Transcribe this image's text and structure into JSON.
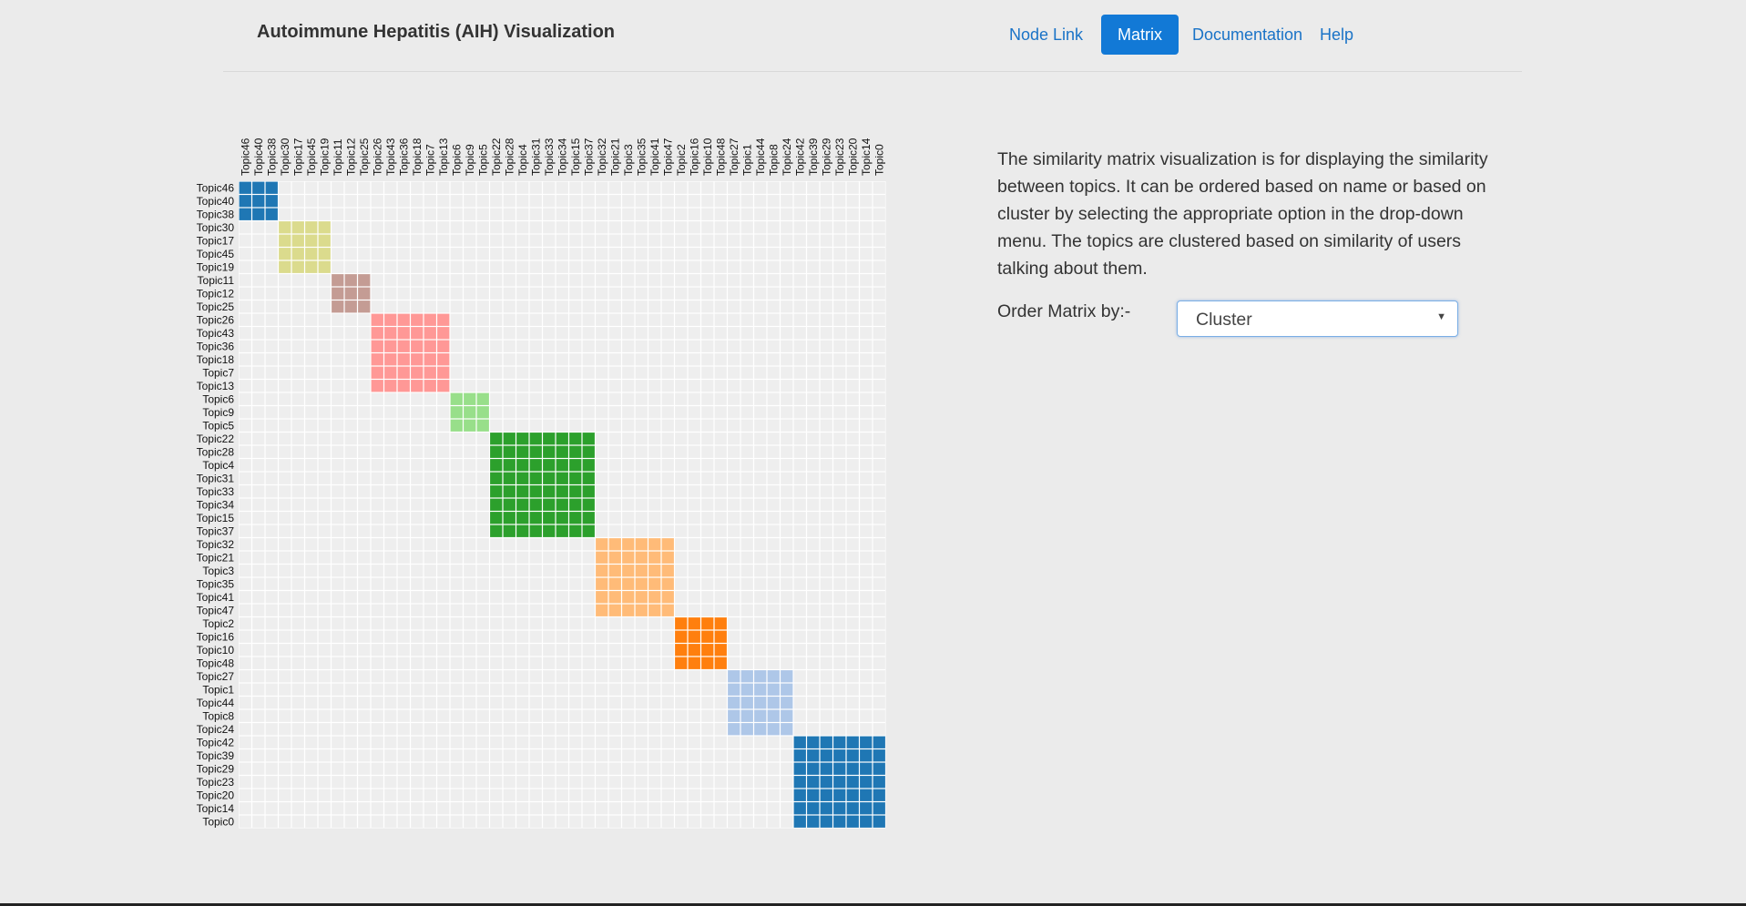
{
  "header": {
    "title": "Autoimmune Hepatitis (AIH) Visualization",
    "nav": [
      {
        "label": "Node Link",
        "active": false
      },
      {
        "label": "Matrix",
        "active": true
      },
      {
        "label": "Documentation",
        "active": false
      },
      {
        "label": "Help",
        "active": false
      }
    ]
  },
  "panel": {
    "description": "The similarity matrix visualization is for displaying the similarity between topics. It can be ordered based on name or based on cluster by selecting the appropriate option in the drop-down menu. The topics are clustered based on similarity of users talking about them.",
    "order_label": "Order Matrix by:-",
    "order_value": "Cluster"
  },
  "colors": {
    "empty_cell": "#eeeeee",
    "grid_line": "#ffffff",
    "accent": "#1279d6"
  },
  "chart_data": {
    "type": "heatmap",
    "topics": [
      "Topic46",
      "Topic40",
      "Topic38",
      "Topic30",
      "Topic17",
      "Topic45",
      "Topic19",
      "Topic11",
      "Topic12",
      "Topic25",
      "Topic26",
      "Topic43",
      "Topic36",
      "Topic18",
      "Topic7",
      "Topic13",
      "Topic6",
      "Topic9",
      "Topic5",
      "Topic22",
      "Topic28",
      "Topic4",
      "Topic31",
      "Topic33",
      "Topic34",
      "Topic15",
      "Topic37",
      "Topic32",
      "Topic21",
      "Topic3",
      "Topic35",
      "Topic41",
      "Topic47",
      "Topic2",
      "Topic16",
      "Topic10",
      "Topic48",
      "Topic27",
      "Topic1",
      "Topic44",
      "Topic8",
      "Topic24",
      "Topic42",
      "Topic39",
      "Topic29",
      "Topic23",
      "Topic20",
      "Topic14",
      "Topic0"
    ],
    "clusters": [
      {
        "size": 3,
        "color": "#1f77b4"
      },
      {
        "size": 4,
        "color": "#dbdb8d"
      },
      {
        "size": 3,
        "color": "#c49c94"
      },
      {
        "size": 6,
        "color": "#ff9896"
      },
      {
        "size": 3,
        "color": "#98df8a"
      },
      {
        "size": 8,
        "color": "#2ca02c"
      },
      {
        "size": 6,
        "color": "#ffbb78"
      },
      {
        "size": 4,
        "color": "#ff7f0e"
      },
      {
        "size": 5,
        "color": "#aec7e8"
      },
      {
        "size": 7,
        "color": "#1f77b4"
      }
    ]
  }
}
